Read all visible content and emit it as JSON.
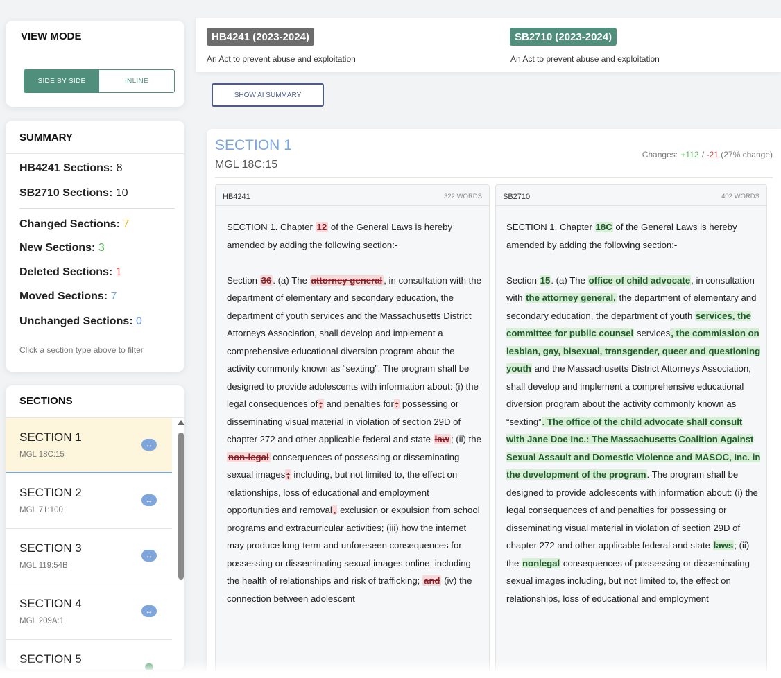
{
  "view_mode": {
    "title": "VIEW MODE",
    "options": [
      "SIDE BY SIDE",
      "INLINE"
    ],
    "selected": "SIDE BY SIDE"
  },
  "summary": {
    "title": "SUMMARY",
    "hb_label": "HB4241 Sections:",
    "hb_value": "8",
    "sb_label": "SB2710 Sections:",
    "sb_value": "10",
    "changed_label": "Changed Sections:",
    "changed_value": "7",
    "new_label": "New Sections:",
    "new_value": "3",
    "deleted_label": "Deleted Sections:",
    "deleted_value": "1",
    "moved_label": "Moved Sections:",
    "moved_value": "7",
    "unchanged_label": "Unchanged Sections:",
    "unchanged_value": "0",
    "hint": "Click a section type above to filter",
    "colors": {
      "changed": "#e0b030",
      "new": "#5cb85c",
      "deleted": "#d9534f",
      "moved": "#7aa8dc",
      "unchanged": "#5a8fd6"
    }
  },
  "sections": {
    "title": "SECTIONS",
    "items": [
      {
        "name": "SECTION 1",
        "mgl": "MGL 18C:15",
        "icon": "swap-icon"
      },
      {
        "name": "SECTION 2",
        "mgl": "MGL 71:100",
        "icon": "swap-icon"
      },
      {
        "name": "SECTION 3",
        "mgl": "MGL 119:54B",
        "icon": "swap-icon"
      },
      {
        "name": "SECTION 4",
        "mgl": "MGL 209A:1",
        "icon": "swap-icon"
      },
      {
        "name": "SECTION 5",
        "mgl": "",
        "icon": "new-icon"
      }
    ]
  },
  "bills": {
    "hb": {
      "badge": "HB4241 (2023-2024)",
      "title": "An Act to prevent abuse and exploitation"
    },
    "sb": {
      "badge": "SB2710 (2023-2024)",
      "title": "An Act to prevent abuse and exploitation"
    }
  },
  "ai_button": "SHOW AI SUMMARY",
  "section_detail": {
    "title": "SECTION 1",
    "mgl": "MGL 18C:15",
    "changes_label": "Changes:",
    "added": "+112",
    "separator": "/",
    "removed": "-21",
    "percent": "(27% change)",
    "left": {
      "bill": "HB4241",
      "words": "322 WORDS"
    },
    "right": {
      "bill": "SB2710",
      "words": "402 WORDS"
    }
  }
}
